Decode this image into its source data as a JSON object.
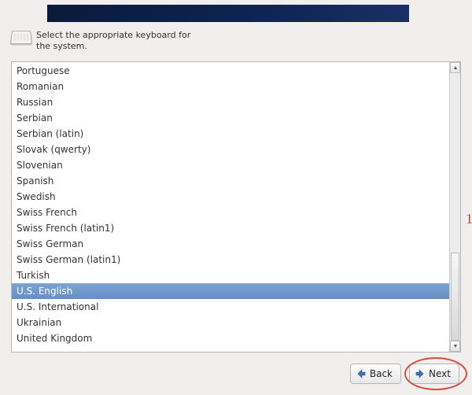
{
  "instruction": {
    "line1": "Select the appropriate keyboard for",
    "line2": "the system."
  },
  "keyboard_layouts": [
    "Portuguese",
    "Romanian",
    "Russian",
    "Serbian",
    "Serbian (latin)",
    "Slovak (qwerty)",
    "Slovenian",
    "Spanish",
    "Swedish",
    "Swiss French",
    "Swiss French (latin1)",
    "Swiss German",
    "Swiss German (latin1)",
    "Turkish",
    "U.S. English",
    "U.S. International",
    "Ukrainian",
    "United Kingdom"
  ],
  "selected_layout": "U.S. English",
  "scrollbar": {
    "thumb_top_pct": 67,
    "thumb_height_pct": 33
  },
  "buttons": {
    "back_label": "Back",
    "next_label": "Next"
  }
}
